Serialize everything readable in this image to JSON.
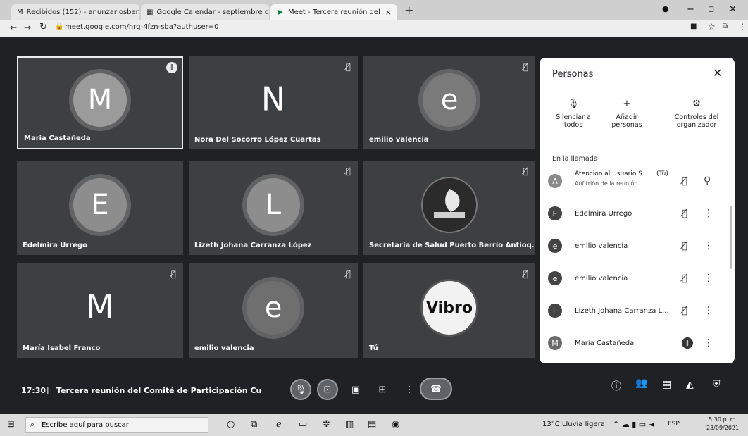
{
  "browser": {
    "tabs": [
      {
        "icon": "gmail-icon",
        "glyph": "M",
        "label": "Recibidos (152) - anunzarlosberi"
      },
      {
        "icon": "calendar-icon",
        "glyph": "▦",
        "label": "Google Calendar - septiembre c"
      },
      {
        "icon": "meet-icon",
        "glyph": "▶",
        "label": "Meet - Tercera reunión del"
      }
    ],
    "new_tab": "+",
    "url": "meet.google.com/hrq-4fzn-sba?authuser=0"
  },
  "tiles": [
    {
      "name": "Maria Castañeda",
      "letter": "M",
      "style": "avatar",
      "muted": false,
      "speaking": true
    },
    {
      "name": "Nora Del Socorro López Cuartas",
      "letter": "N",
      "style": "big",
      "muted": true
    },
    {
      "name": "emilio valencia",
      "letter": "e",
      "style": "avatar",
      "muted": true
    },
    {
      "name": "Edelmira Urrego",
      "letter": "E",
      "style": "avatar",
      "muted": false
    },
    {
      "name": "Lizeth Johana Carranza López",
      "letter": "L",
      "style": "avatar",
      "muted": true
    },
    {
      "name": "Secretaría de Salud Puerto Berrío Antioq...",
      "letter": "",
      "style": "logo",
      "muted": true
    },
    {
      "name": "María Isabel Franco",
      "letter": "M",
      "style": "big",
      "muted": true
    },
    {
      "name": "emilio valencia",
      "letter": "e",
      "style": "avatar",
      "muted": true
    },
    {
      "name": "Tú",
      "letter": "Vibro",
      "style": "vibro",
      "muted": true
    }
  ],
  "meeting": {
    "time": "17:30",
    "separator": "|",
    "title": "Tercera reunión del Comité de Participación Cu"
  },
  "people_panel": {
    "title": "Personas",
    "actions": [
      {
        "icon": "mic-off-icon",
        "glyph": "🎙",
        "label_line1": "Silenciar a",
        "label_line2": "todos"
      },
      {
        "icon": "add-person-icon",
        "glyph": "+",
        "label_line1": "Añadir",
        "label_line2": "personas"
      },
      {
        "icon": "host-controls-icon",
        "glyph": "⚙",
        "label_line1": "Controles del",
        "label_line2": "organizador"
      }
    ],
    "section": "En la llamada",
    "participants": [
      {
        "initial": "A",
        "name": "Atencion al Usuario S...",
        "you": "(Tú)",
        "subtitle": "Anfitrión de la reunión",
        "right": "pin"
      },
      {
        "initial": "E",
        "name": "Edelmira Urrego",
        "right": "more"
      },
      {
        "initial": "e",
        "name": "emilio valencia",
        "right": "more"
      },
      {
        "initial": "e",
        "name": "emilio valencia",
        "right": "more"
      },
      {
        "initial": "L",
        "name": "Lizeth Johana Carranza L...",
        "right": "more"
      },
      {
        "initial": "M",
        "name": "Maria Castañeda",
        "right": "more",
        "speaking": true
      }
    ]
  },
  "taskbar": {
    "search_placeholder": "Escribe aquí para buscar",
    "weather": "13°C Lluvia ligera",
    "lang": "ESP",
    "time": "5:30 p. m.",
    "date": "23/09/2021"
  }
}
